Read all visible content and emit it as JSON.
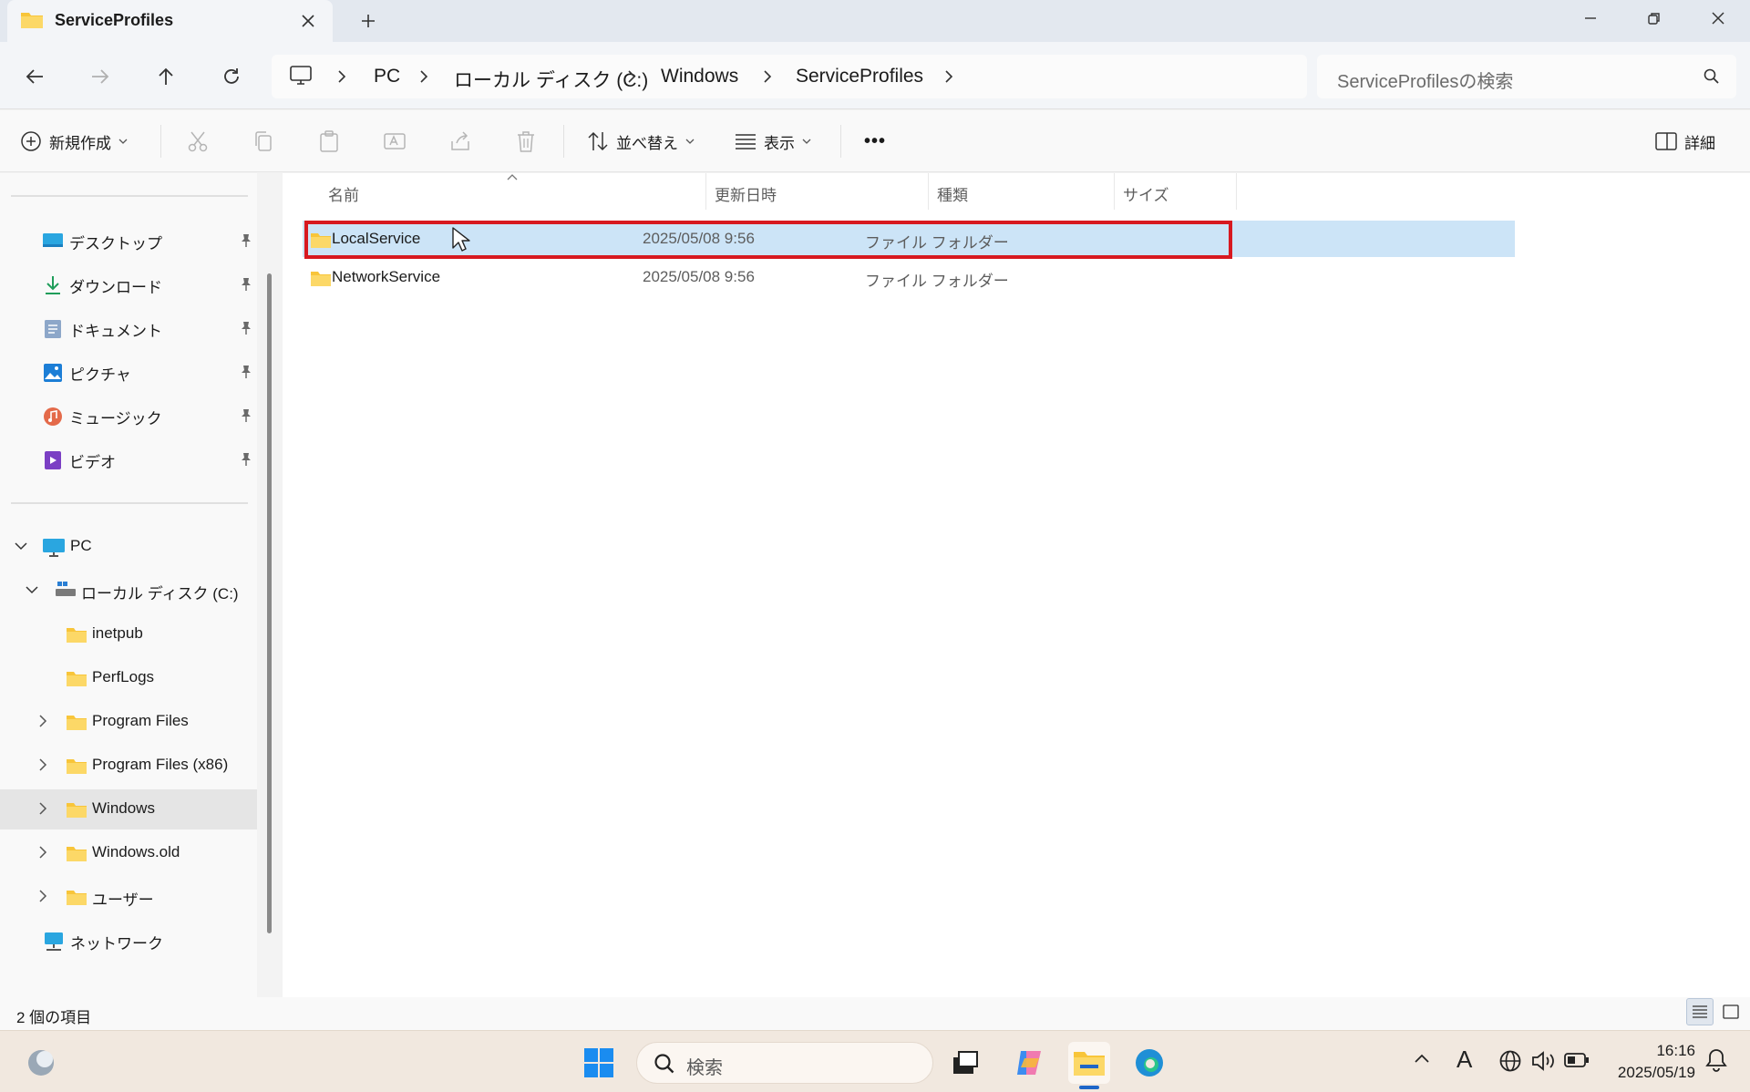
{
  "window": {
    "tab_title": "ServiceProfiles",
    "close_glyph": "×",
    "new_tab_glyph": "+"
  },
  "breadcrumb": [
    "PC",
    "ローカル ディスク (C:)",
    "Windows",
    "ServiceProfiles"
  ],
  "search": {
    "placeholder": "ServiceProfilesの検索"
  },
  "toolbar": {
    "new_label": "新規作成",
    "sort_label": "並べ替え",
    "view_label": "表示",
    "more_label": "•••",
    "details_label": "詳細"
  },
  "sidebar": {
    "quick_access": [
      {
        "label": "デスクトップ",
        "icon": "desktop-icon"
      },
      {
        "label": "ダウンロード",
        "icon": "download-icon"
      },
      {
        "label": "ドキュメント",
        "icon": "document-icon"
      },
      {
        "label": "ピクチャ",
        "icon": "pictures-icon"
      },
      {
        "label": "ミュージック",
        "icon": "music-icon"
      },
      {
        "label": "ビデオ",
        "icon": "video-icon"
      }
    ],
    "pc_label": "PC",
    "drive_label": "ローカル ディスク (C:)",
    "folders": [
      "inetpub",
      "PerfLogs",
      "Program Files",
      "Program Files (x86)",
      "Windows",
      "Windows.old",
      "ユーザー"
    ],
    "network_label": "ネットワーク",
    "selected_folder": "Windows"
  },
  "columns": {
    "name": "名前",
    "date": "更新日時",
    "type": "種類",
    "size": "サイズ"
  },
  "files": [
    {
      "name": "LocalService",
      "date": "2025/05/08 9:56",
      "type": "ファイル フォルダー",
      "size": ""
    },
    {
      "name": "NetworkService",
      "date": "2025/05/08 9:56",
      "type": "ファイル フォルダー",
      "size": ""
    }
  ],
  "status": {
    "item_count": "2 個の項目"
  },
  "taskbar": {
    "search_label": "検索",
    "time": "16:16",
    "date": "2025/05/19",
    "ime_label": "A"
  },
  "colors": {
    "selection": "#cce4f7",
    "highlight_border": "#d71920",
    "folder": "#f8c53a",
    "accent": "#0067c0"
  }
}
